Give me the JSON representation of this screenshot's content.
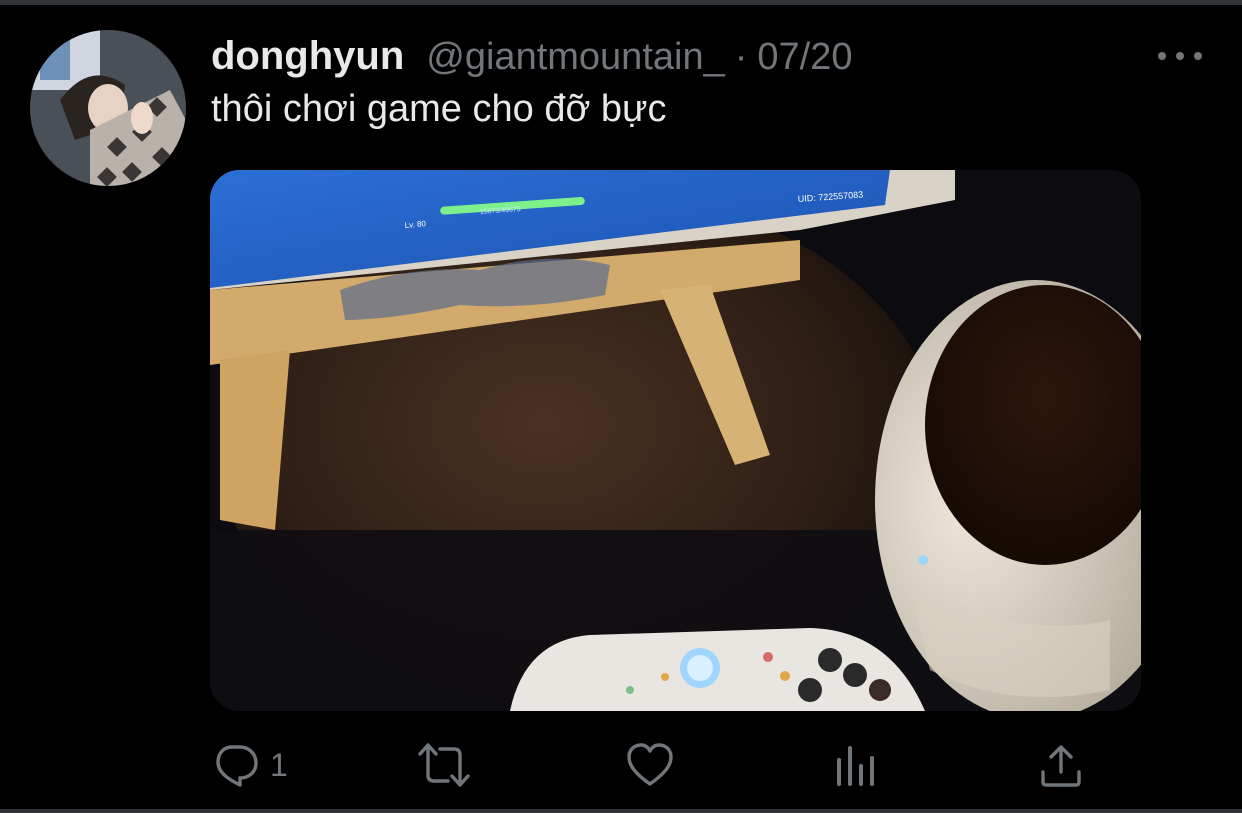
{
  "tweet": {
    "author": {
      "display_name": "donghyun",
      "handle": "@giantmountain_",
      "avatar_icon": "profile-photo"
    },
    "separator": "·",
    "date": "07/20",
    "text": "thôi chơi game cho đỡ bực",
    "media": {
      "level_label": "Lv. 80",
      "uid_label": "UID: 722557083",
      "xp_label": "15670/49675"
    },
    "actions": {
      "reply_count": "1",
      "icons": [
        "reply-icon",
        "retweet-icon",
        "like-icon",
        "analytics-icon",
        "share-icon"
      ]
    }
  },
  "colors": {
    "background": "#000000",
    "text": "#e7e9ea",
    "secondary": "#71767b",
    "divider": "#2f3336"
  }
}
